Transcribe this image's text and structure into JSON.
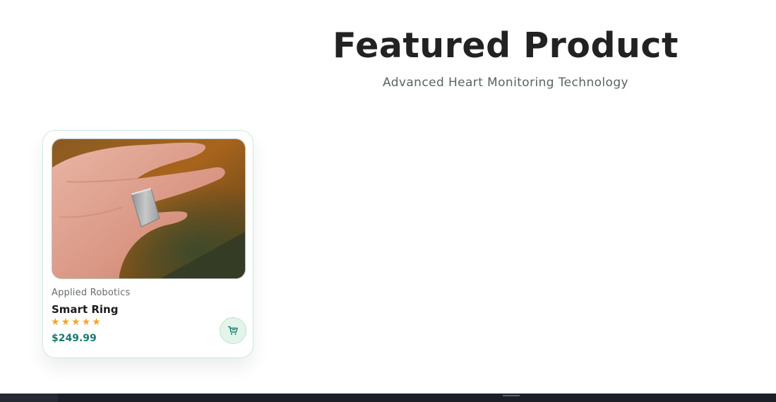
{
  "header": {
    "title": "Featured Product",
    "subtitle": "Advanced Heart Monitoring Technology"
  },
  "product": {
    "image_alt": "hand wearing a silver smart ring",
    "brand": "Applied Robotics",
    "name": "Smart Ring",
    "rating": 5,
    "rating_max": 5,
    "price": "$249.99",
    "cart_icon": "cart-icon"
  },
  "colors": {
    "accent": "#1b7a6e",
    "star": "#f5a623",
    "card_border": "#cfe8e0",
    "cart_bg": "#e3f5ea",
    "taskbar": "#1c1f26"
  }
}
